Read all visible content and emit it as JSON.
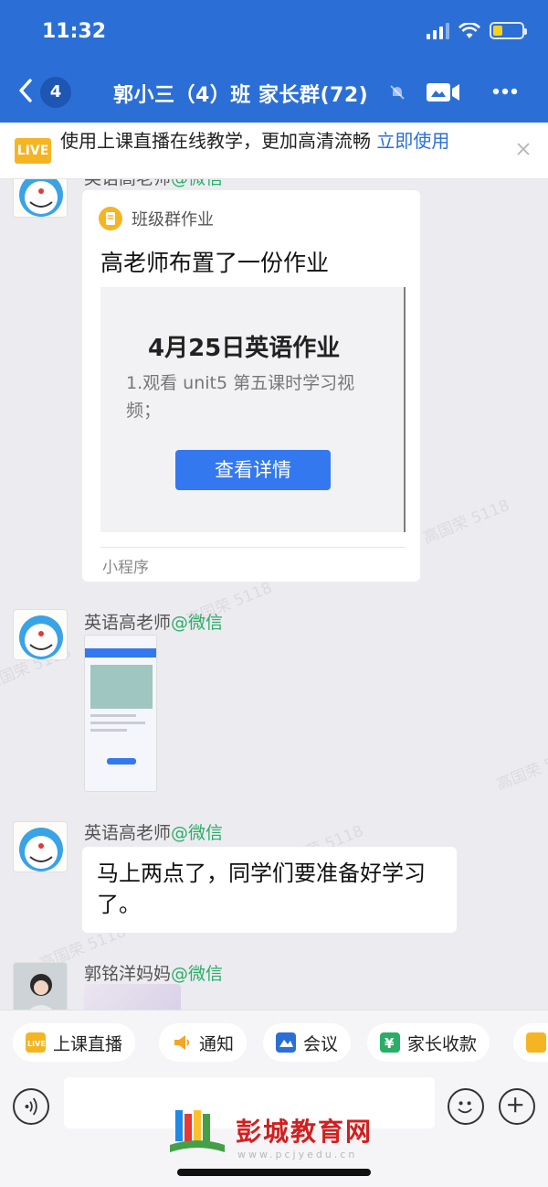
{
  "status": {
    "time": "11:32"
  },
  "header": {
    "unread_count": "4",
    "title": "郭小三（4）班 家长群(72)"
  },
  "live_banner": {
    "tag": "LIVE",
    "text": "使用上课直播在线教学，更加高清流畅 ",
    "link": "立即使用"
  },
  "messages": [
    {
      "sender": "英语高老师",
      "sender_suffix": "@微信",
      "type": "mini_program",
      "card_header": "班级群作业",
      "card_title": "高老师布置了一份作业",
      "preview_title": "4月25日英语作业",
      "preview_line": "1.观看 unit5 第五课时学习视频；",
      "preview_button": "查看详情",
      "footer": "小程序"
    },
    {
      "sender": "英语高老师",
      "sender_suffix": "@微信",
      "type": "image"
    },
    {
      "sender": "英语高老师",
      "sender_suffix": "@微信",
      "type": "text",
      "text": "马上两点了，同学们要准备好学习了。"
    },
    {
      "sender": "郭铭洋妈妈",
      "sender_suffix": "@微信",
      "type": "image"
    }
  ],
  "watermark": "高国荣 5118",
  "quick_actions": [
    {
      "label": "上课直播",
      "icon": "live-icon",
      "color": "#f5b523"
    },
    {
      "label": "通知",
      "icon": "megaphone-icon",
      "color": "#f5a623"
    },
    {
      "label": "会议",
      "icon": "meeting-icon",
      "color": "#2b6fd6"
    },
    {
      "label": "家长收款",
      "icon": "yuan-icon",
      "color": "#2aae67"
    }
  ],
  "input": {
    "placeholder": ""
  },
  "logo": {
    "text": "彭城教育网",
    "url": "www.pcjyedu.cn"
  },
  "colors": {
    "brand_blue": "#2b6fd6",
    "wechat_green": "#2aae67",
    "live_yellow": "#f5b523"
  }
}
